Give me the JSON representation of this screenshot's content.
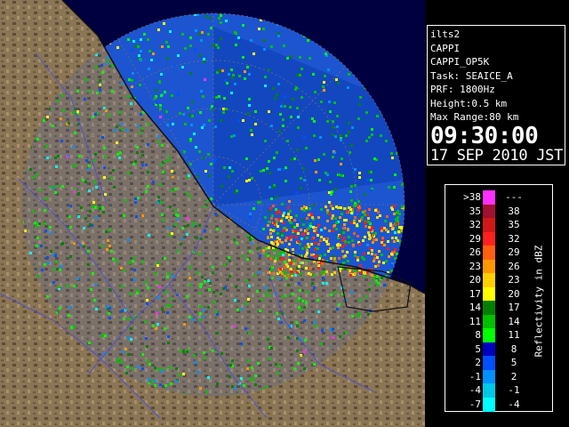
{
  "info": {
    "station": "ilts2",
    "product": "CAPPI",
    "product_code": "CAPPI_OP5K",
    "task": "Task: SEAICE_A",
    "prf": "PRF: 1800Hz",
    "height": "Height:0.5 km",
    "max_range": "Max Range:80 km",
    "time": "09:30:00",
    "date": "17 SEP 2010 JST"
  },
  "legend": {
    "title": "Reflectivity in dBZ",
    "rows": [
      {
        "lo": ">38",
        "hi": "---",
        "color": "#ff30ff"
      },
      {
        "lo": "35",
        "hi": "38",
        "color": "#a01030"
      },
      {
        "lo": "32",
        "hi": "35",
        "color": "#d01818"
      },
      {
        "lo": "29",
        "hi": "32",
        "color": "#ff2020"
      },
      {
        "lo": "26",
        "hi": "29",
        "color": "#ff6010"
      },
      {
        "lo": "23",
        "hi": "26",
        "color": "#ff9800"
      },
      {
        "lo": "20",
        "hi": "23",
        "color": "#ffd000"
      },
      {
        "lo": "17",
        "hi": "20",
        "color": "#ffff00"
      },
      {
        "lo": "14",
        "hi": "17",
        "color": "#008000"
      },
      {
        "lo": "11",
        "hi": "14",
        "color": "#00c000"
      },
      {
        "lo": "8",
        "hi": "11",
        "color": "#00ff00"
      },
      {
        "lo": "5",
        "hi": "8",
        "color": "#0000c0"
      },
      {
        "lo": "2",
        "hi": "5",
        "color": "#0050ff"
      },
      {
        "lo": "-1",
        "hi": "2",
        "color": "#0090ff"
      },
      {
        "lo": "-4",
        "hi": "-1",
        "color": "#00c8e8"
      },
      {
        "lo": "-7",
        "hi": "-4",
        "color": "#00ffff"
      }
    ]
  },
  "colors": {
    "background": "#000000",
    "sea": "#000040",
    "land": "#8a7555",
    "land_dark": "#5a4a35",
    "coast": "#101010",
    "rivers": "#5050d0",
    "range_rings": "#606060",
    "echo_base": "#1f5ad8"
  }
}
